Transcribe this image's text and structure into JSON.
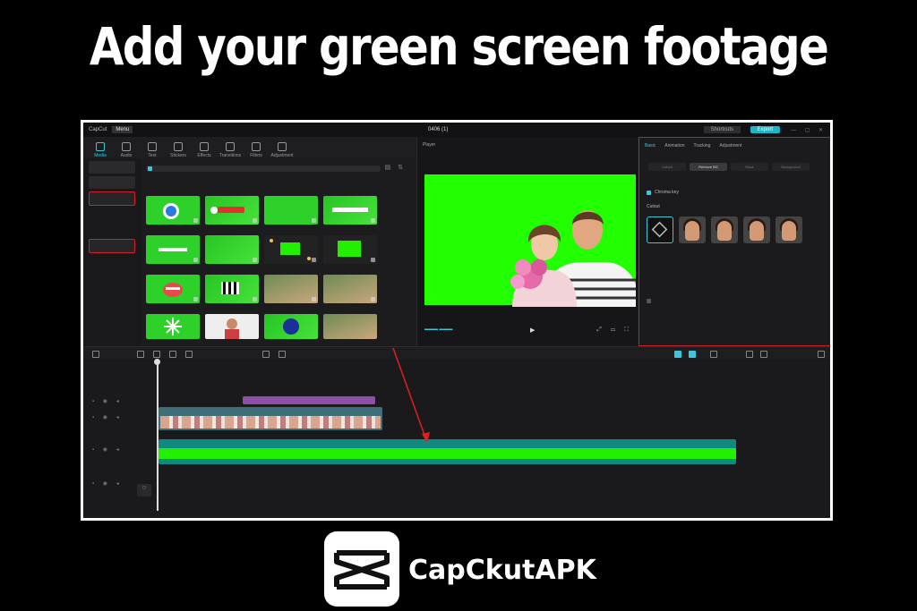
{
  "headline": "Add your green screen footage",
  "brand": {
    "name": "CapCkutAPK",
    "logo_icon": "capcut-logo-icon"
  },
  "app": {
    "titlebar": {
      "app_name": "CapCut",
      "menu_label": "Menu",
      "project_name": "0406 (1)",
      "shortcuts_label": "Shortcuts",
      "export_label": "Export"
    },
    "toolbar": {
      "tools": [
        "Media",
        "Audio",
        "Text",
        "Stickers",
        "Effects",
        "Transitions",
        "Filters",
        "Adjustment"
      ]
    },
    "player": {
      "title": "Player"
    },
    "details": {
      "tabs": [
        "Basic",
        "Animation",
        "Tracking",
        "Adjustment"
      ],
      "subtabs": [
        "Cutout",
        "Remove BG",
        "Mask",
        "Background"
      ],
      "option_label": "Chroma key",
      "section_label": "Cutout"
    },
    "accent_color": "#1fb5c7",
    "highlight_color": "#d21f2b",
    "green_screen_color": "#22ff00"
  }
}
